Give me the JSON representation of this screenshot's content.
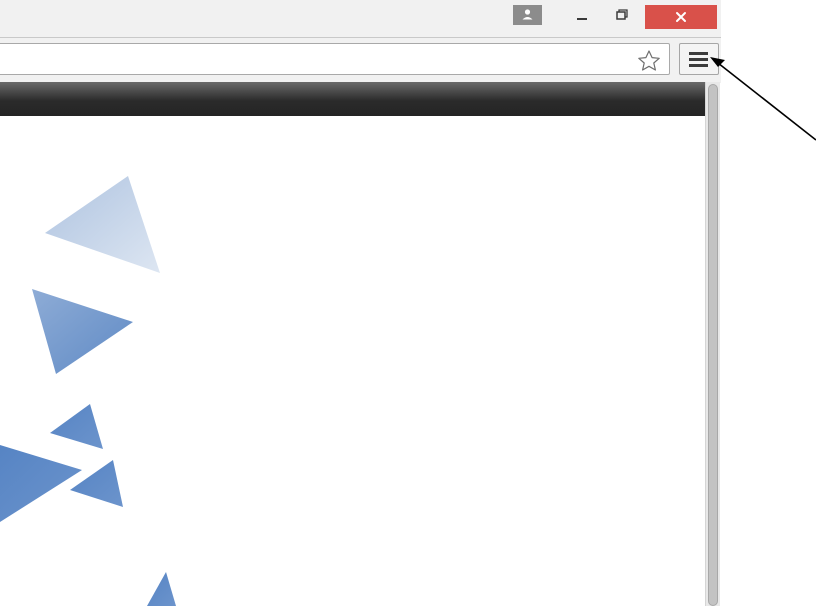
{
  "window": {
    "buttons": [
      {
        "name": "profile",
        "icon": "person-icon"
      },
      {
        "name": "minimize",
        "icon": "minimize-icon"
      },
      {
        "name": "restore",
        "icon": "restore-icon"
      },
      {
        "name": "close",
        "icon": "close-icon"
      }
    ]
  },
  "toolbar": {
    "address_value": "",
    "bookmark_icon": "star-icon",
    "menu_icon": "hamburger-menu-icon"
  },
  "colors": {
    "close_button": "#d9514a",
    "chrome_bg": "#f1f1f1",
    "page_header": "#2b2b2b",
    "triangle_light": "#c5d4e8",
    "triangle_blue": "#5a87c5"
  },
  "annotation": {
    "type": "arrow",
    "points_to": "hamburger-menu-icon"
  }
}
